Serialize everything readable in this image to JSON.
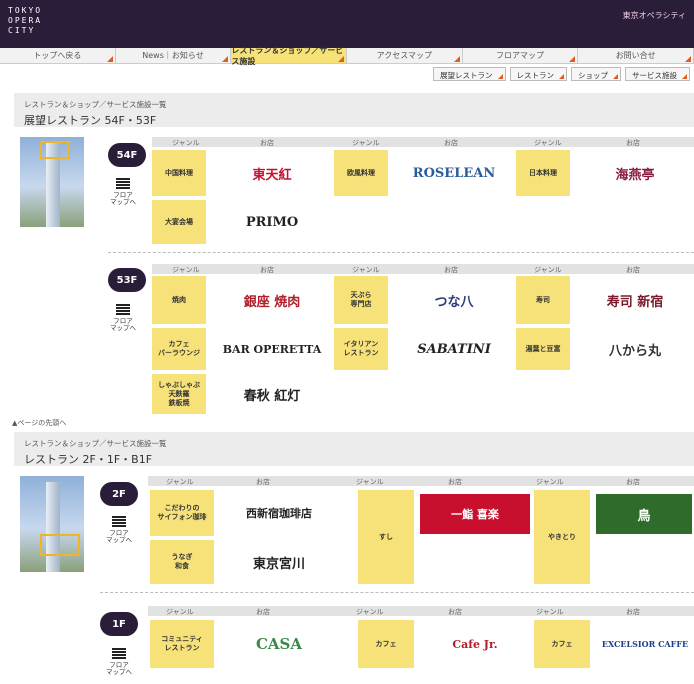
{
  "header": {
    "logo_lines": [
      "TOKYO",
      "OPERA",
      "CITY"
    ],
    "top_link": "東京オペラシティ"
  },
  "nav": [
    "トップへ戻る",
    "News｜お知らせ",
    "レストラン＆ショップ／サービス施設",
    "アクセスマップ",
    "フロアマップ",
    "お問い合せ"
  ],
  "subnav": [
    "展望レストラン",
    "レストラン",
    "ショップ",
    "サービス施設"
  ],
  "section1": {
    "small": "レストラン＆ショップ／サービス施設一覧",
    "title": "展望レストラン 54F・53F",
    "floors": [
      {
        "label": "54F",
        "map_label": "フロア\nマップへ",
        "col_headers": [
          "ジャンル",
          "お店",
          "ジャンル",
          "お店",
          "ジャンル",
          "お店"
        ],
        "rows": [
          [
            {
              "genre": "中国料理",
              "shop": "東天紅"
            },
            {
              "genre": "欧風料理",
              "shop": "ROSELEAN"
            },
            {
              "genre": "日本料理",
              "shop": "海燕亭"
            }
          ],
          [
            {
              "genre": "大宴会場",
              "shop": "PRIMO"
            }
          ]
        ]
      },
      {
        "label": "53F",
        "map_label": "フロア\nマップへ",
        "col_headers": [
          "ジャンル",
          "お店",
          "ジャンル",
          "お店",
          "ジャンル",
          "お店"
        ],
        "rows": [
          [
            {
              "genre": "焼肉",
              "shop": "銀座 焼肉"
            },
            {
              "genre": "天ぷら\n専門店",
              "shop": "つな八"
            },
            {
              "genre": "寿司",
              "shop": "寿司 新宿"
            }
          ],
          [
            {
              "genre": "カフェ\nバーラウンジ",
              "shop": "BAR OPERETTA"
            },
            {
              "genre": "イタリアン\nレストラン",
              "shop": "SABATINI"
            },
            {
              "genre": "湯葉と豆富",
              "shop": "八から丸"
            }
          ],
          [
            {
              "genre": "しゃぶしゃぶ\n天麩羅\n鉄板焼",
              "shop": "春秋 紅灯"
            }
          ]
        ]
      }
    ]
  },
  "page_top": "▲ページの先頭へ",
  "section2": {
    "small": "レストラン＆ショップ／サービス施設一覧",
    "title": "レストラン 2F・1F・B1F",
    "floors": [
      {
        "label": "2F",
        "map_label": "フロア\nマップへ",
        "col_headers": [
          "ジャンル",
          "お店",
          "ジャンル",
          "お店",
          "ジャンル",
          "お店"
        ],
        "rows": [
          [
            {
              "genre": "こだわりの\nサイフォン珈琲",
              "shop": "西新宿珈琲店"
            },
            {
              "genre": "すし",
              "shop": "一鮨 喜楽"
            },
            {
              "genre": "やきとり",
              "shop": "鳥"
            }
          ],
          [
            {
              "genre": "うなぎ\n和食",
              "shop": "東京宮川"
            }
          ]
        ]
      },
      {
        "label": "1F",
        "map_label": "フロア\nマップへ",
        "col_headers": [
          "ジャンル",
          "お店",
          "ジャンル",
          "お店",
          "ジャンル",
          "お店"
        ],
        "rows": [
          [
            {
              "genre": "コミュニティ\nレストラン",
              "shop": "CASA"
            },
            {
              "genre": "カフェ",
              "shop": "Cafe Jr."
            },
            {
              "genre": "カフェ",
              "shop": "EXCELSIOR CAFFE"
            }
          ]
        ]
      }
    ]
  },
  "colors": {
    "header_bg": "#2a1d3a",
    "genre_bg": "#f7e27a",
    "accent_arrow": "#e85a1c",
    "highlight": "#f0b42a",
    "red_logo": "#c8102e"
  }
}
